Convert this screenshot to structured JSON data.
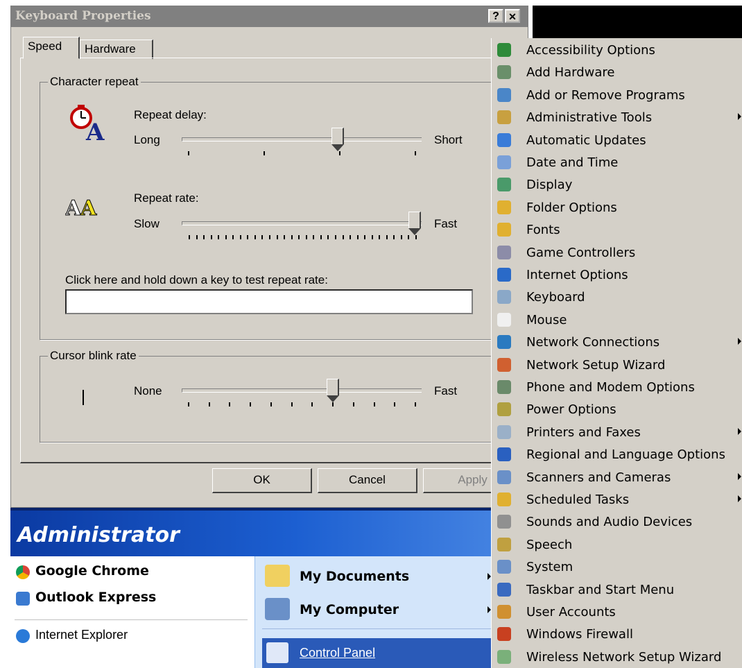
{
  "dialog": {
    "title": "Keyboard Properties",
    "help_btn": "?",
    "close_btn": "✕",
    "tabs": [
      "Speed",
      "Hardware"
    ],
    "char_repeat": {
      "group_label": "Character repeat",
      "delay_label": "Repeat delay:",
      "delay_left": "Long",
      "delay_right": "Short",
      "delay_value": 0.66,
      "rate_label": "Repeat rate:",
      "rate_left": "Slow",
      "rate_right": "Fast",
      "rate_value": 1.0,
      "test_label": "Click here and hold down a key to test repeat rate:",
      "test_value": ""
    },
    "cursor_blink": {
      "group_label": "Cursor blink rate",
      "left": "None",
      "right": "Fast",
      "value": 0.64
    },
    "buttons": {
      "ok": "OK",
      "cancel": "Cancel",
      "apply": "Apply"
    }
  },
  "start_menu": {
    "user": "Administrator",
    "left_items": [
      "Google Chrome",
      "Outlook Express"
    ],
    "left_more": "Internet Explorer",
    "right_items": [
      "My Documents",
      "My Computer",
      "Control Panel"
    ]
  },
  "control_panel": {
    "items": [
      {
        "label": "Accessibility Options",
        "icon": "accessibility-icon",
        "color": "#2e8b3a",
        "arrow": false
      },
      {
        "label": "Add Hardware",
        "icon": "add-hardware-icon",
        "color": "#6a8f6a",
        "arrow": false
      },
      {
        "label": "Add or Remove Programs",
        "icon": "add-remove-programs-icon",
        "color": "#4a86c8",
        "arrow": false
      },
      {
        "label": "Administrative Tools",
        "icon": "administrative-tools-icon",
        "color": "#c8a040",
        "arrow": true
      },
      {
        "label": "Automatic Updates",
        "icon": "automatic-updates-icon",
        "color": "#3a7cd8",
        "arrow": false
      },
      {
        "label": "Date and Time",
        "icon": "date-time-icon",
        "color": "#7aa0d8",
        "arrow": false
      },
      {
        "label": "Display",
        "icon": "display-icon",
        "color": "#4a9a6a",
        "arrow": false
      },
      {
        "label": "Folder Options",
        "icon": "folder-options-icon",
        "color": "#e0b030",
        "arrow": false
      },
      {
        "label": "Fonts",
        "icon": "fonts-icon",
        "color": "#e0b030",
        "arrow": false
      },
      {
        "label": "Game Controllers",
        "icon": "game-controllers-icon",
        "color": "#8c8ca8",
        "arrow": false
      },
      {
        "label": "Internet Options",
        "icon": "internet-options-icon",
        "color": "#2a6ac8",
        "arrow": false
      },
      {
        "label": "Keyboard",
        "icon": "keyboard-icon",
        "color": "#8aa8c8",
        "arrow": false
      },
      {
        "label": "Mouse",
        "icon": "mouse-icon",
        "color": "#f0f0f0",
        "arrow": false
      },
      {
        "label": "Network Connections",
        "icon": "network-connections-icon",
        "color": "#2a7ac0",
        "arrow": true
      },
      {
        "label": "Network Setup Wizard",
        "icon": "network-setup-wizard-icon",
        "color": "#d06030",
        "arrow": false
      },
      {
        "label": "Phone and Modem Options",
        "icon": "phone-modem-icon",
        "color": "#6a8a6a",
        "arrow": false
      },
      {
        "label": "Power Options",
        "icon": "power-options-icon",
        "color": "#b0a040",
        "arrow": false
      },
      {
        "label": "Printers and Faxes",
        "icon": "printers-faxes-icon",
        "color": "#9ab0c8",
        "arrow": true
      },
      {
        "label": "Regional and Language Options",
        "icon": "regional-language-icon",
        "color": "#2a60c0",
        "arrow": false
      },
      {
        "label": "Scanners and Cameras",
        "icon": "scanners-cameras-icon",
        "color": "#6a90c8",
        "arrow": true
      },
      {
        "label": "Scheduled Tasks",
        "icon": "scheduled-tasks-icon",
        "color": "#e0b030",
        "arrow": true
      },
      {
        "label": "Sounds and Audio Devices",
        "icon": "sounds-audio-icon",
        "color": "#909090",
        "arrow": false
      },
      {
        "label": "Speech",
        "icon": "speech-icon",
        "color": "#c0a040",
        "arrow": false
      },
      {
        "label": "System",
        "icon": "system-icon",
        "color": "#6a90c8",
        "arrow": false
      },
      {
        "label": "Taskbar and Start Menu",
        "icon": "taskbar-start-menu-icon",
        "color": "#3a6ac0",
        "arrow": false
      },
      {
        "label": "User Accounts",
        "icon": "user-accounts-icon",
        "color": "#d09030",
        "arrow": false
      },
      {
        "label": "Windows Firewall",
        "icon": "windows-firewall-icon",
        "color": "#c84020",
        "arrow": false
      },
      {
        "label": "Wireless Network Setup Wizard",
        "icon": "wireless-network-wizard-icon",
        "color": "#7ab07a",
        "arrow": false
      }
    ]
  }
}
